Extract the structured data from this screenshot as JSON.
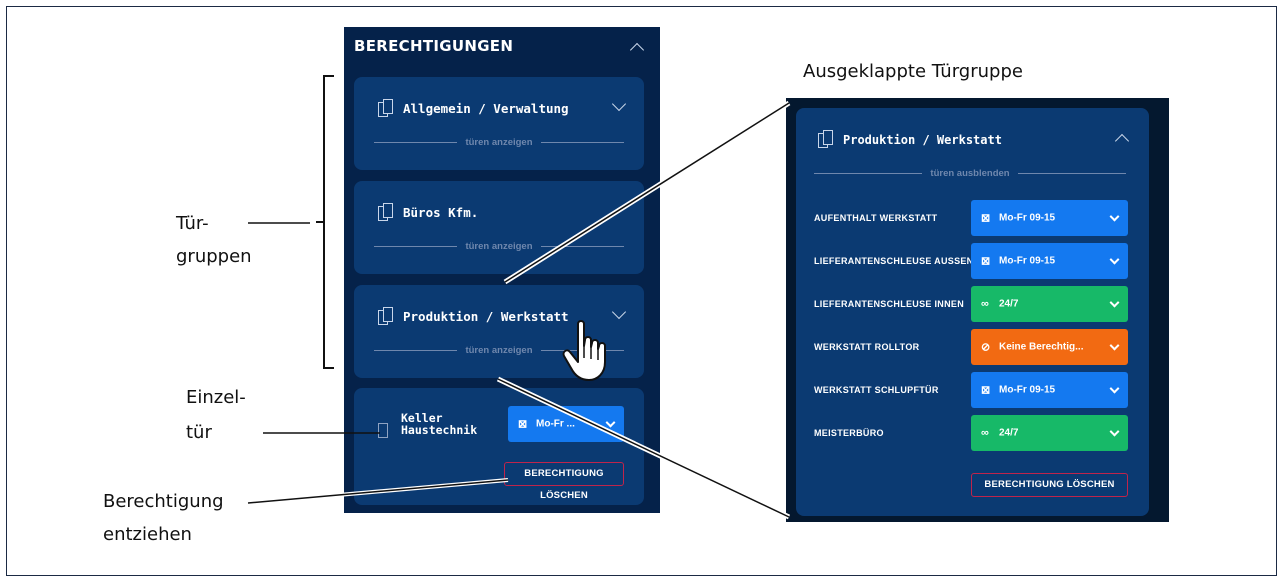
{
  "callouts": {
    "turgruppen_1": "Tür-",
    "turgruppen_2": "gruppen",
    "einzeltur_1": "Einzel-",
    "einzeltur_2": "tür",
    "entziehen_1": "Berechtigung",
    "entziehen_2": "entziehen",
    "ausgeklappt": "Ausgeklappte Türgruppe"
  },
  "left_panel": {
    "title": "BERECHTIGUNGEN",
    "groups": [
      {
        "name": "Allgemein / Verwaltung",
        "toggle": "türen anzeigen"
      },
      {
        "name": "Büros Kfm.",
        "toggle": "türen anzeigen"
      },
      {
        "name": "Produktion / Werkstatt",
        "toggle": "türen anzeigen"
      }
    ],
    "single_door": {
      "name_line1": "Keller",
      "name_line2": "Haustechnik",
      "schedule": "Mo-Fr ...",
      "schedule_color": "#1479f0",
      "delete_label": "BERECHTIGUNG LÖSCHEN"
    }
  },
  "right_panel": {
    "group_name": "Produktion / Werkstatt",
    "toggle": "türen ausblenden",
    "doors": [
      {
        "label": "AUFENTHALT WERKSTATT",
        "schedule": "Mo-Fr 09-15",
        "icon": "⊠",
        "color": "#1479f0"
      },
      {
        "label": "LIEFERANTENSCHLEUSE AUSSEN",
        "schedule": "Mo-Fr 09-15",
        "icon": "⊠",
        "color": "#1479f0"
      },
      {
        "label": "LIEFERANTENSCHLEUSE INNEN",
        "schedule": "24/7",
        "icon": "∞",
        "color": "#17b968"
      },
      {
        "label": "WERKSTATT ROLLTOR",
        "schedule": "Keine Berechtig...",
        "icon": "⊘",
        "color": "#f26a12"
      },
      {
        "label": "WERKSTATT SCHLUPFTÜR",
        "schedule": "Mo-Fr 09-15",
        "icon": "⊠",
        "color": "#1479f0"
      },
      {
        "label": "MEISTERBÜRO",
        "schedule": "24/7",
        "icon": "∞",
        "color": "#17b968"
      }
    ],
    "delete_label": "BERECHTIGUNG LÖSCHEN"
  }
}
